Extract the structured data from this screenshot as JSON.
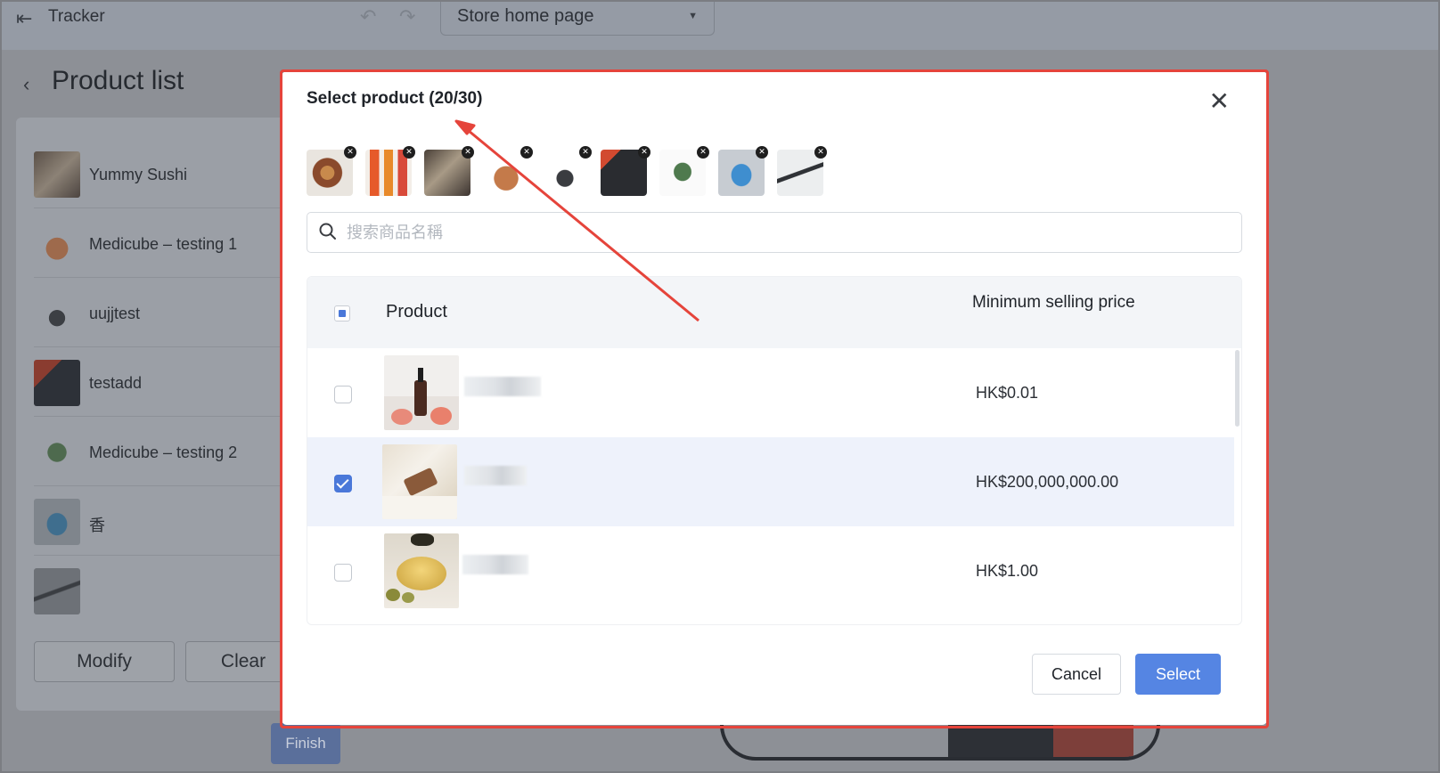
{
  "topbar": {
    "app_title": "Tracker",
    "page_select_value": "Store home page"
  },
  "background": {
    "page_title": "Product list",
    "items": [
      {
        "label": "Yummy Sushi",
        "icon": "sushi-thumbnail"
      },
      {
        "label": "Medicube – testing 1",
        "icon": "plant-pot-thumbnail"
      },
      {
        "label": "uujjtest",
        "icon": "watch-thumbnail"
      },
      {
        "label": "testadd",
        "icon": "phone-thumbnail"
      },
      {
        "label": "Medicube – testing 2",
        "icon": "cactus-thumbnail"
      },
      {
        "label": "香",
        "icon": "bottle-thumbnail"
      },
      {
        "label": "",
        "icon": "pen-thumbnail"
      }
    ],
    "modify_label": "Modify",
    "clear_label": "Clear",
    "finish_label": "Finish"
  },
  "modal": {
    "title": "Select product (20/30)",
    "selected_chips": [
      {
        "name": "pizza"
      },
      {
        "name": "juice-drinks"
      },
      {
        "name": "sushi"
      },
      {
        "name": "plant-pot"
      },
      {
        "name": "smartwatch"
      },
      {
        "name": "phone-case"
      },
      {
        "name": "cactus"
      },
      {
        "name": "blue-bottle"
      },
      {
        "name": "pen"
      }
    ],
    "search": {
      "placeholder": "搜索商品名稱",
      "value": ""
    },
    "table": {
      "col_product": "Product",
      "col_price": "Minimum selling price",
      "rows": [
        {
          "price": "HK$0.01",
          "checked": false,
          "image": "serum-bottle-with-roses"
        },
        {
          "price": "HK$200,000,000.00",
          "checked": true,
          "image": "soap-on-cloth"
        },
        {
          "price": "HK$1.00",
          "checked": false,
          "image": "olive-oil-bowl"
        }
      ]
    },
    "cancel_label": "Cancel",
    "select_label": "Select"
  },
  "colors": {
    "accent": "#5585e3",
    "annotation_red": "#e5443b",
    "selected_row": "#eef2fb"
  }
}
